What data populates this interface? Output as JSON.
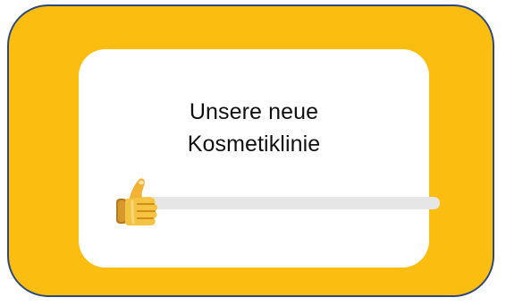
{
  "poll": {
    "question_line1": "Unsere neue",
    "question_line2": "Kosmetiklinie",
    "slider_value": 0,
    "slider_emoji": "thumbs-up-icon"
  },
  "colors": {
    "outer_background": "#fbbd10",
    "outer_border": "#2f4a7a",
    "card_background": "#ffffff",
    "track": "#e6e6e6"
  }
}
